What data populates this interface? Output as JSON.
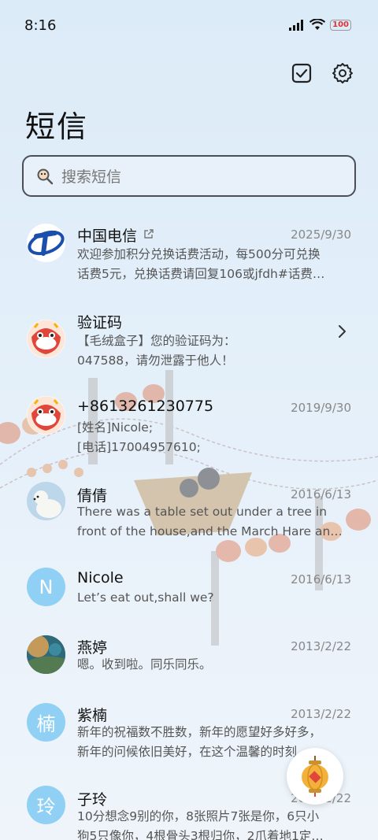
{
  "status": {
    "time": "8:16",
    "battery": "100"
  },
  "page": {
    "title": "短信"
  },
  "search": {
    "placeholder": "搜索短信"
  },
  "messages": [
    {
      "name": "中国电信",
      "date": "2025/9/30",
      "line1": "欢迎参加积分兑换话费活动，每500分可兑换",
      "line2": "话费5元，兑换话费请回复106或jfdh#话费…"
    },
    {
      "name": "验证码",
      "date": "",
      "line1": "【毛绒盒子】您的验证码为：",
      "line2": "047588，请勿泄露于他人！"
    },
    {
      "name": "+8613261230775",
      "date": "2019/9/30",
      "line1": "[姓名]Nicole;",
      "line2": "[电话]17004957610;"
    },
    {
      "name": "倩倩",
      "date": "2016/6/13",
      "line1": "There was a table set out under a tree in",
      "line2": "front of the house,and the March Hare an…"
    },
    {
      "name": "Nicole",
      "date": "2016/6/13",
      "avatar_letter": "N",
      "line1": "Let’s eat out,shall we?",
      "line2": ""
    },
    {
      "name": "燕婷",
      "date": "2013/2/22",
      "line1": "嗯。收到啦。同乐同乐。",
      "line2": ""
    },
    {
      "name": "紫楠",
      "date": "2013/2/22",
      "avatar_letter": "楠",
      "line1": "新年的祝福数不胜数，新年的愿望好多好多，",
      "line2": "新年的问候依旧美好，在这个温馨的时刻…"
    },
    {
      "name": "子玲",
      "date": "2013/2/22",
      "avatar_letter": "玲",
      "line1": "10分想念9别的你，8张照片7张是你，6只小",
      "line2": "狗5只像你，4根骨头3根归你，2爪着地1定…"
    }
  ]
}
